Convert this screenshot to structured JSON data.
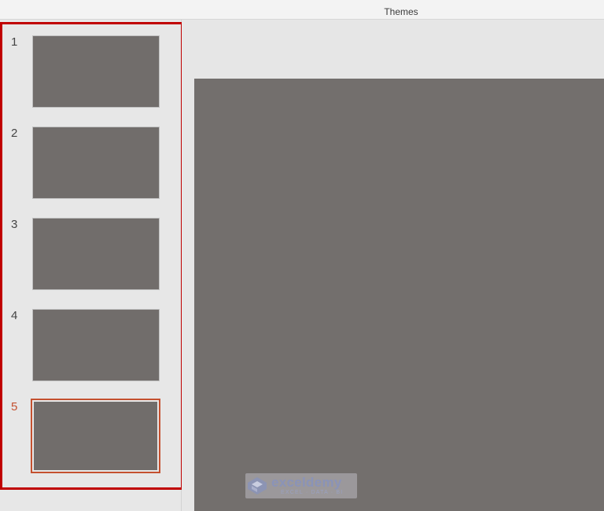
{
  "ribbon": {
    "group_label": "Themes"
  },
  "slides": [
    {
      "number": "1",
      "selected": false
    },
    {
      "number": "2",
      "selected": false
    },
    {
      "number": "3",
      "selected": false
    },
    {
      "number": "4",
      "selected": false
    },
    {
      "number": "5",
      "selected": true
    }
  ],
  "watermark": {
    "name": "exceldemy",
    "tagline": "EXCEL · DATA · BI",
    "icon": "exceldemy-logo-icon"
  },
  "colors": {
    "slide_fill": "#716d6b",
    "selection_accent": "#c4502f",
    "highlight_border": "#c00000"
  }
}
